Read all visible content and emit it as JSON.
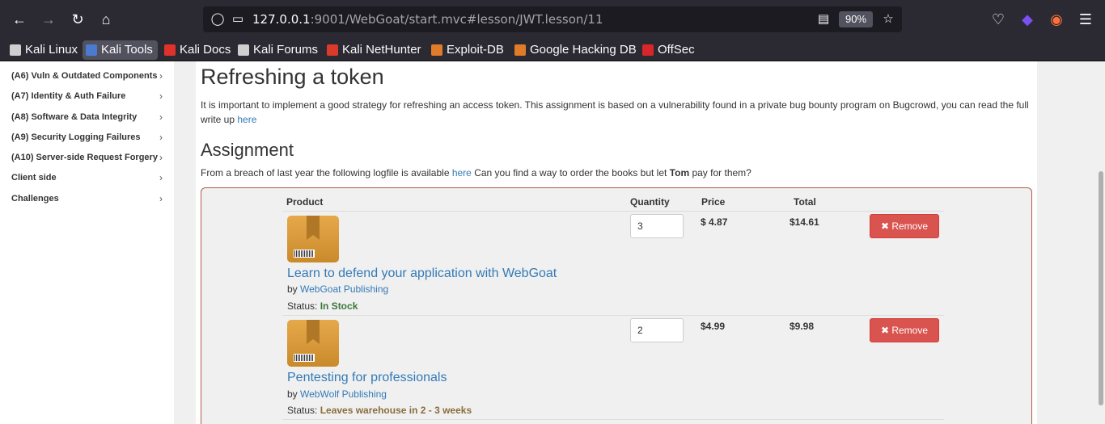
{
  "browser": {
    "url_host": "127.0.0.1",
    "url_rest": ":9001/WebGoat/start.mvc#lesson/JWT.lesson/11",
    "zoom": "90%",
    "bookmarks": [
      {
        "label": "Kali Linux",
        "color": "#e0e0e0"
      },
      {
        "label": "Kali Tools",
        "color": "#4a7bd0"
      },
      {
        "label": "Kali Docs",
        "color": "#e0312a"
      },
      {
        "label": "Kali Forums",
        "color": "#e0e0e0"
      },
      {
        "label": "Kali NetHunter",
        "color": "#d93a2a"
      },
      {
        "label": "Exploit-DB",
        "color": "#e07b2a"
      },
      {
        "label": "Google Hacking DB",
        "color": "#e07b2a"
      },
      {
        "label": "OffSec",
        "color": "#d9262a"
      }
    ]
  },
  "sidebar": {
    "items": [
      {
        "label": "(A6) Vuln & Outdated Components"
      },
      {
        "label": "(A7) Identity & Auth Failure"
      },
      {
        "label": "(A8) Software & Data Integrity"
      },
      {
        "label": "(A9) Security Logging Failures"
      },
      {
        "label": "(A10) Server-side Request Forgery"
      },
      {
        "label": "Client side"
      },
      {
        "label": "Challenges"
      }
    ]
  },
  "lesson": {
    "title": "Refreshing a token",
    "intro_1": "It is important to implement a good strategy for refreshing an access token. This assignment is based on a vulnerability found in a private bug bounty program on Bugcrowd, you can read the full write up ",
    "intro_link": "here",
    "assignment_title": "Assignment",
    "assign_1": "From a breach of last year the following logfile is available ",
    "assign_link": "here",
    "assign_2": " Can you find a way to order the books but let ",
    "assign_bold": "Tom",
    "assign_3": " pay for them?"
  },
  "cart": {
    "headers": {
      "product": "Product",
      "quantity": "Quantity",
      "price": "Price",
      "total": "Total"
    },
    "remove_label": "Remove",
    "items": [
      {
        "title": "Learn to defend your application with WebGoat",
        "by": "by ",
        "publisher": "WebGoat Publishing",
        "status_label": "Status: ",
        "status": "In Stock",
        "quantity": "3",
        "price": "$ 4.87",
        "total": "$14.61"
      },
      {
        "title": "Pentesting for professionals",
        "by": "by ",
        "publisher": "WebWolf Publishing",
        "status_label": "Status: ",
        "status": "Leaves warehouse in 2 - 3 weeks",
        "quantity": "2",
        "price": "$4.99",
        "total": "$9.98"
      }
    ]
  }
}
